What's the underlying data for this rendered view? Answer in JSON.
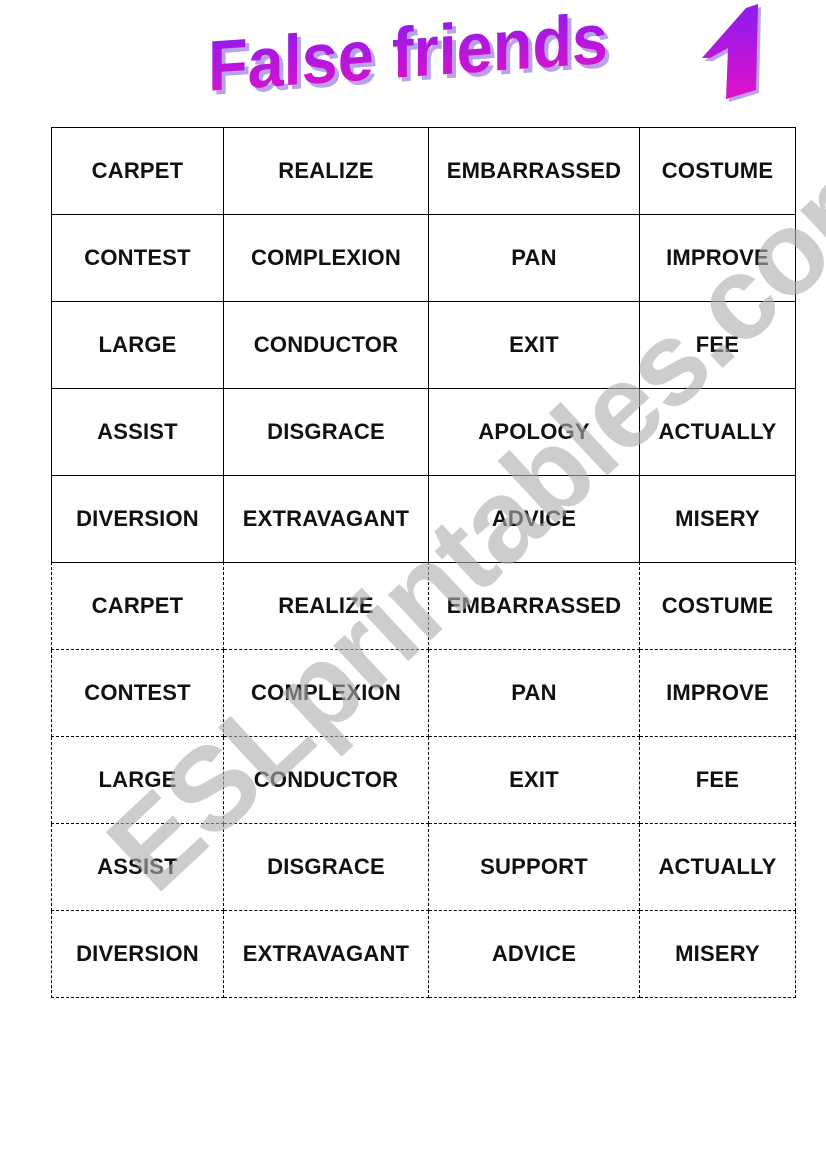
{
  "header": {
    "title": "False friends",
    "number": "1",
    "colors": {
      "gradient_top": "#8a1cf0",
      "gradient_bottom": "#e011c8",
      "shadow": "#b9a3e8"
    }
  },
  "watermark": {
    "text": "ESLprintables.com",
    "color": "#b4b4b4"
  },
  "tables": [
    {
      "border": "solid",
      "rows": [
        [
          "CARPET",
          "REALIZE",
          "EMBARRASSED",
          "COSTUME"
        ],
        [
          "CONTEST",
          "COMPLEXION",
          "PAN",
          "IMPROVE"
        ],
        [
          "LARGE",
          "CONDUCTOR",
          "EXIT",
          "FEE"
        ],
        [
          "ASSIST",
          "DISGRACE",
          "APOLOGY",
          "ACTUALLY"
        ],
        [
          "DIVERSION",
          "EXTRAVAGANT",
          "ADVICE",
          "MISERY"
        ]
      ]
    },
    {
      "border": "dashed",
      "rows": [
        [
          "CARPET",
          "REALIZE",
          "EMBARRASSED",
          "COSTUME"
        ],
        [
          "CONTEST",
          "COMPLEXION",
          "PAN",
          "IMPROVE"
        ],
        [
          "LARGE",
          "CONDUCTOR",
          "EXIT",
          "FEE"
        ],
        [
          "ASSIST",
          "DISGRACE",
          "SUPPORT",
          "ACTUALLY"
        ],
        [
          "DIVERSION",
          "EXTRAVAGANT",
          "ADVICE",
          "MISERY"
        ]
      ]
    }
  ]
}
